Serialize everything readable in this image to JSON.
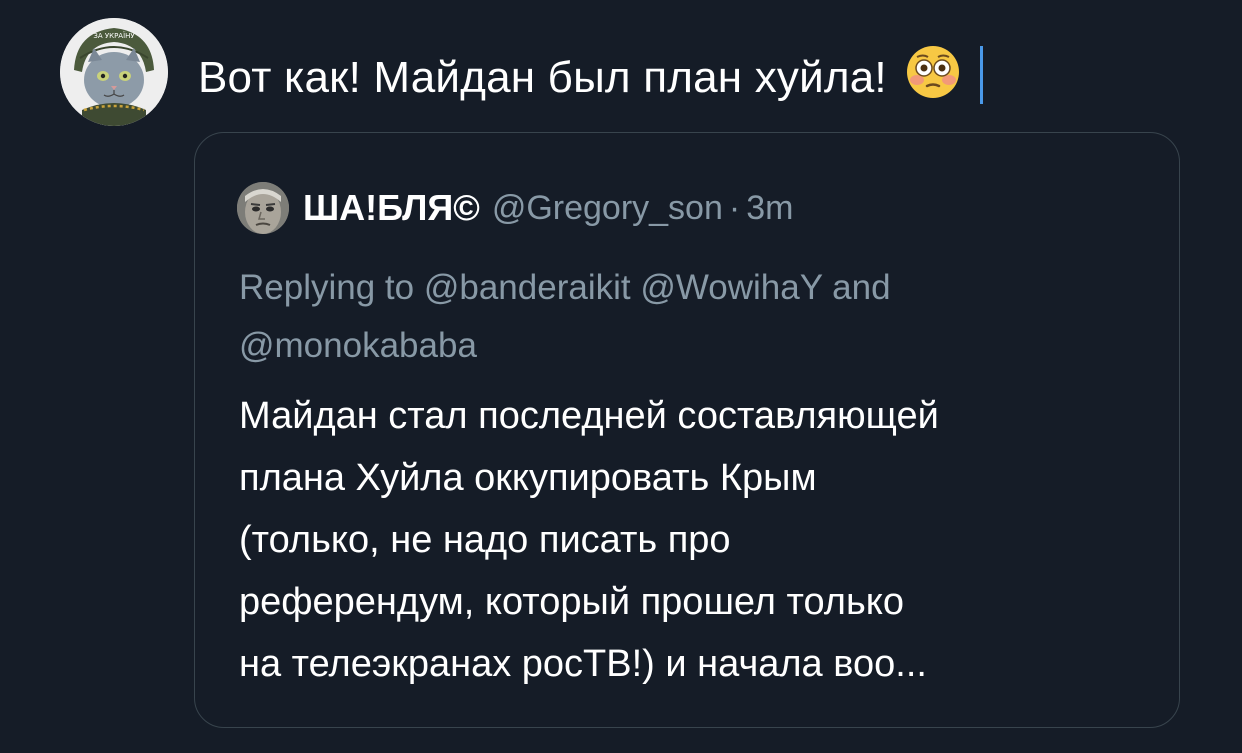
{
  "compose": {
    "text": "Вот как! Майдан был план хуйла!",
    "emoji_icon": "flushed-face-emoji-icon",
    "avatar_icon": "cat-in-helmet-avatar",
    "avatar_badge_text": "ЗА УКРАЇНУ"
  },
  "quoted_tweet": {
    "display_name": "ША!БЛЯ©",
    "handle": "@Gregory_son",
    "separator": "·",
    "time": "3m",
    "replying_to_prefix": "Replying to",
    "replying_to_users": [
      "@banderaikit",
      "@WowihaY"
    ],
    "replying_to_and": "and",
    "replying_to_last": "@monokababa",
    "body_lines": [
      "Майдан стал последней составляющей",
      "плана Хуйла оккупировать Крым",
      "(только, не надо писать про",
      "референдум, который прошел только",
      "на телеэкранах росТВ!) и начала воо..."
    ]
  },
  "colors": {
    "background": "#151c27",
    "text": "#ffffff",
    "muted": "#8899a6",
    "border": "#38444d",
    "caret": "#4a99e9"
  }
}
